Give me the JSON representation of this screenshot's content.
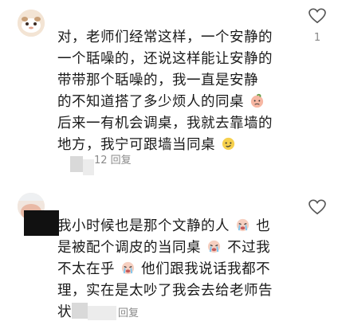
{
  "comments": [
    {
      "text_lines": [
        "对，老师们经常这样，一个安静的",
        "一个聒噪的，还说这样能让安静的",
        "带带那个聒噪的，我一直是安静",
        "的不知道搭了多少烦人的同桌",
        "后来一有机会调桌，我就去靠墙的",
        "地方，我宁可跟墙当同桌"
      ],
      "emojis": [
        "sad-peach-emoji",
        "smirk-emoji"
      ],
      "meta_text": "12 回复",
      "like_count": "1"
    },
    {
      "text_lines": [
        "我小时候也是那个文静的人",
        "也",
        "是被配个调皮的当同桌",
        "不过我",
        "不太在乎",
        "他们跟我说话我都不",
        "理，实在是太吵了我会去给老师告",
        "状"
      ],
      "emojis": [
        "crying-emoji",
        "crying-emoji",
        "crying-emoji"
      ],
      "meta_text": "回复",
      "like_count": ""
    }
  ],
  "colors": {
    "text": "#1a1a1a",
    "muted": "#8a8a8a",
    "placeholder": "#d9d9d9"
  },
  "icons": {
    "like": "heart-outline-icon"
  }
}
